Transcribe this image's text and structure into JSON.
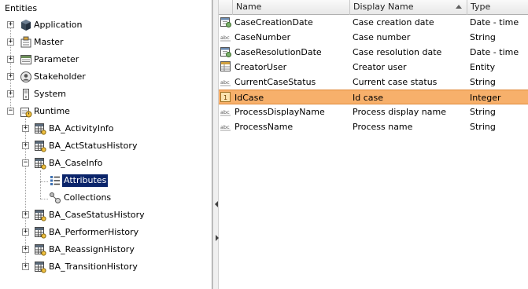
{
  "left_pane": {
    "title": "Entities",
    "tree": [
      {
        "label": "Application",
        "icon": "cube-icon",
        "expander": "+"
      },
      {
        "label": "Master",
        "icon": "master-icon",
        "expander": "+"
      },
      {
        "label": "Parameter",
        "icon": "parameter-icon",
        "expander": "+"
      },
      {
        "label": "Stakeholder",
        "icon": "stakeholder-icon",
        "expander": "+"
      },
      {
        "label": "System",
        "icon": "system-icon",
        "expander": "+"
      },
      {
        "label": "Runtime",
        "icon": "runtime-icon",
        "expander": "−"
      },
      {
        "label": "BA_ActivityInfo",
        "icon": "entity-table-icon",
        "expander": "+"
      },
      {
        "label": "BA_ActStatusHistory",
        "icon": "entity-table-icon",
        "expander": "+"
      },
      {
        "label": "BA_CaseInfo",
        "icon": "entity-table-icon",
        "expander": "−"
      },
      {
        "label": "Attributes",
        "icon": "attributes-icon",
        "expander": ""
      },
      {
        "label": "Collections",
        "icon": "collections-icon",
        "expander": ""
      },
      {
        "label": "BA_CaseStatusHistory",
        "icon": "entity-table-icon",
        "expander": "+"
      },
      {
        "label": "BA_PerformerHistory",
        "icon": "entity-table-icon",
        "expander": "+"
      },
      {
        "label": "BA_ReassignHistory",
        "icon": "entity-table-icon",
        "expander": "+"
      },
      {
        "label": "BA_TransitionHistory",
        "icon": "entity-table-icon",
        "expander": "+"
      }
    ]
  },
  "grid": {
    "columns": [
      "Name",
      "Display Name",
      "Type"
    ],
    "rows": [
      {
        "name": "CaseCreationDate",
        "display": "Case creation date",
        "type": "Date - time",
        "icon": "calendar-icon",
        "selected": false
      },
      {
        "name": "CaseNumber",
        "display": "Case number",
        "type": "String",
        "icon": "abc-icon",
        "selected": false
      },
      {
        "name": "CaseResolutionDate",
        "display": "Case resolution date",
        "type": "Date - time",
        "icon": "calendar-icon",
        "selected": false
      },
      {
        "name": "CreatorUser",
        "display": "Creator user",
        "type": "Entity",
        "icon": "entity-icon",
        "selected": false
      },
      {
        "name": "CurrentCaseStatus",
        "display": "Current case status",
        "type": "String",
        "icon": "abc-icon",
        "selected": false
      },
      {
        "name": "IdCase",
        "display": "Id case",
        "type": "Integer",
        "icon": "integer-icon",
        "selected": true
      },
      {
        "name": "ProcessDisplayName",
        "display": "Process display name",
        "type": "String",
        "icon": "abc-icon",
        "selected": false
      },
      {
        "name": "ProcessName",
        "display": "Process name",
        "type": "String",
        "icon": "abc-icon",
        "selected": false
      }
    ]
  },
  "colors": {
    "selection_row": "#f7b06b",
    "tree_selection": "#0a246a"
  }
}
